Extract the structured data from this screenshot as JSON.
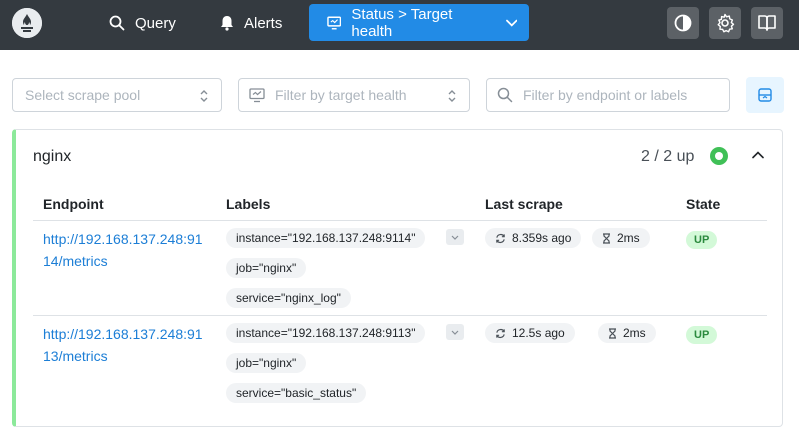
{
  "nav": {
    "query_label": "Query",
    "alerts_label": "Alerts",
    "status_label": "Status > Target health"
  },
  "filters": {
    "scrape_pool_placeholder": "Select scrape pool",
    "health_placeholder": "Filter by target health",
    "search_placeholder": "Filter by endpoint or labels"
  },
  "colors": {
    "header_bg": "#343a40",
    "accent": "#228be6",
    "healthy": "#40c057",
    "link": "#1c7ed6"
  },
  "pool": {
    "name": "nginx",
    "count": "2 / 2 up",
    "health": "up"
  },
  "table": {
    "headers": {
      "endpoint": "Endpoint",
      "labels": "Labels",
      "last_scrape": "Last scrape",
      "state": "State"
    },
    "rows": [
      {
        "endpoint": "http://192.168.137.248:9114/metrics",
        "labels": [
          "instance=\"192.168.137.248:9114\"",
          "job=\"nginx\"",
          "service=\"nginx_log\""
        ],
        "last_scrape": "8.359s ago",
        "duration": "2ms",
        "state": "UP"
      },
      {
        "endpoint": "http://192.168.137.248:9113/metrics",
        "labels": [
          "instance=\"192.168.137.248:9113\"",
          "job=\"nginx\"",
          "service=\"basic_status\""
        ],
        "last_scrape": "12.5s ago",
        "duration": "2ms",
        "state": "UP"
      }
    ]
  }
}
